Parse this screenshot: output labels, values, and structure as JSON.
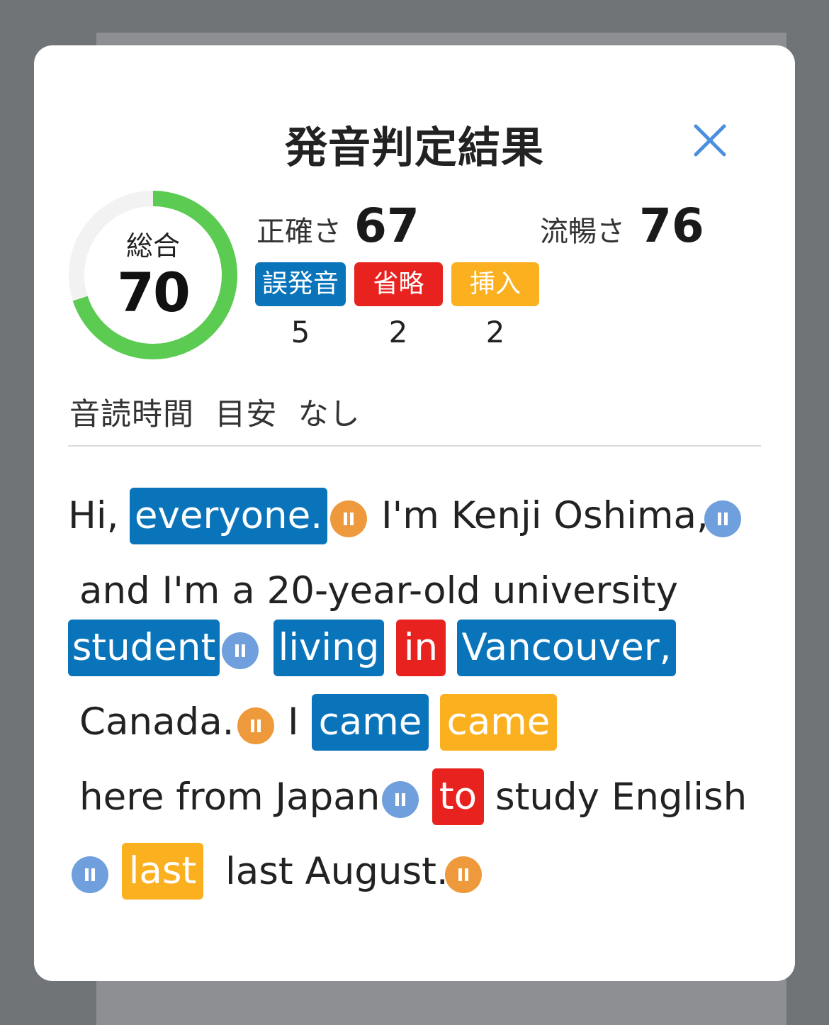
{
  "title": "発音判定結果",
  "close_icon": "close-icon",
  "overall": {
    "label": "総合",
    "score": "70",
    "progress": 0.7,
    "color": "#5ccb52"
  },
  "accuracy": {
    "label": "正確さ",
    "value": "67"
  },
  "fluency": {
    "label": "流暢さ",
    "value": "76"
  },
  "badges": [
    {
      "label": "誤発音",
      "count": "5",
      "color": "#0a74bb"
    },
    {
      "label": "省略",
      "count": "2",
      "color": "#e8231f"
    },
    {
      "label": "挿入",
      "count": "2",
      "color": "#fbb020"
    }
  ],
  "reading_time": "音読時間  目安  なし",
  "transcript": {
    "t1": "Hi,",
    "t2": "everyone.",
    "t3": "I'm Kenji Oshima,",
    "t4": "and I'm a 20-year-old university",
    "t5": "student",
    "t6": "living",
    "t7": "in",
    "t8": "Vancouver,",
    "t9": "Canada.",
    "t10": "I",
    "t11": "came",
    "t12": "came",
    "t13": "here from Japan",
    "t14": "to",
    "t15": "study English",
    "t16": "last",
    "t17": "last August."
  },
  "legend_colors": {
    "mispronunciation": "#0a74bb",
    "omission": "#e8231f",
    "insertion": "#fbb020",
    "pause_blue": "#6f9fdc",
    "pause_orange": "#ee9a3c"
  }
}
